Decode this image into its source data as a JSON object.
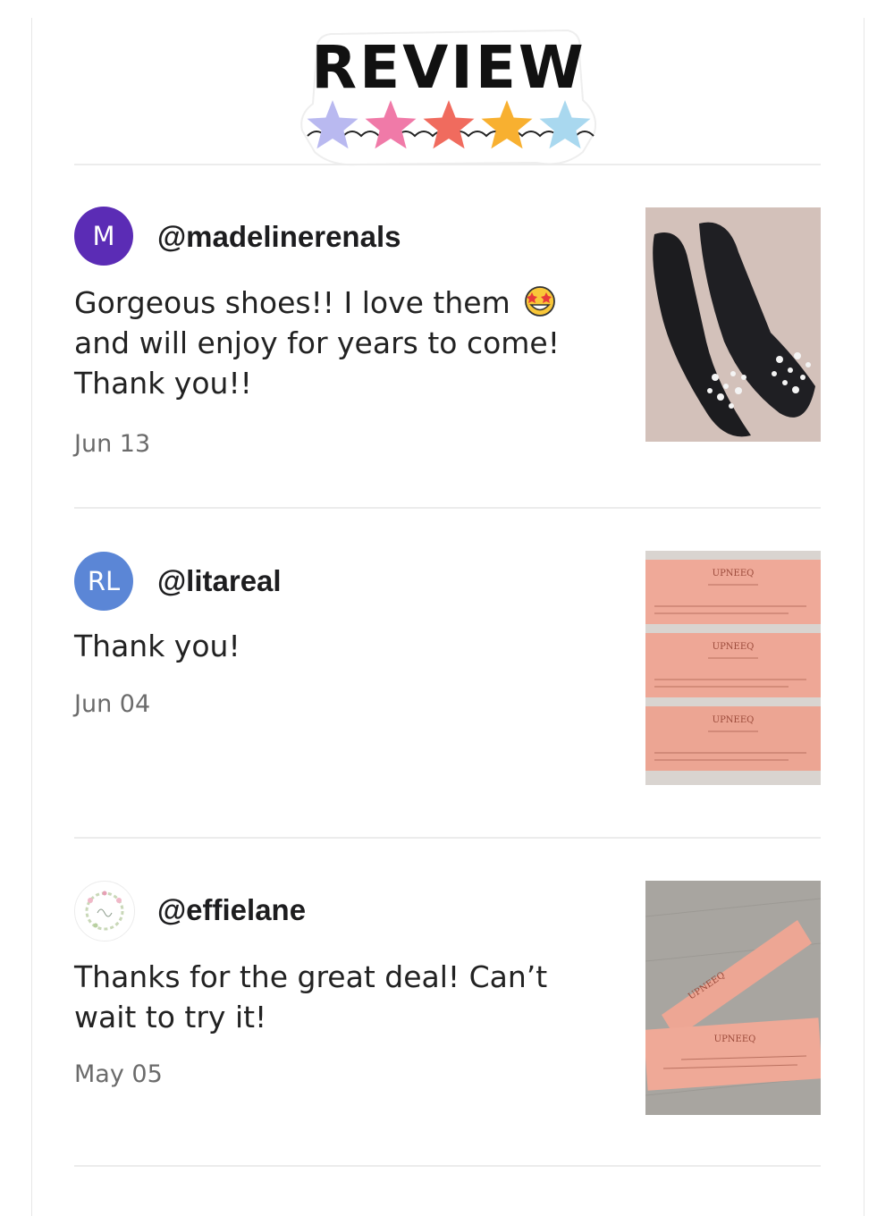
{
  "header": {
    "title": "REVIEW",
    "star_colors": [
      "#b9b9f0",
      "#f07aa8",
      "#f06b5e",
      "#f8b030",
      "#a9d8ef"
    ]
  },
  "reviews": [
    {
      "avatar_initials": "M",
      "avatar_color": "#5b2cb5",
      "handle": "@madelinerenals",
      "text": "Gorgeous shoes!! I love them",
      "text_line2": "and will enjoy for years to come!",
      "text_line3": "Thank you!!",
      "emoji_icon": "star-struck-emoji",
      "date": "Jun 13",
      "photo": "black-flat-shoes"
    },
    {
      "avatar_initials": "RL",
      "avatar_color": "#5b86d6",
      "handle": "@litareal",
      "text": "Thank you!",
      "date": "Jun 04",
      "photo": "three-pink-packets",
      "packet_label": "UPNEEQ"
    },
    {
      "avatar_initials": "",
      "avatar_logo": "floral-wreath-logo",
      "handle": "@effielane",
      "text": "Thanks for the great deal! Can’t",
      "text_line2": "wait to try it!",
      "date": "May 05",
      "photo": "two-pink-packets",
      "packet_label": "UPNEEQ"
    }
  ]
}
